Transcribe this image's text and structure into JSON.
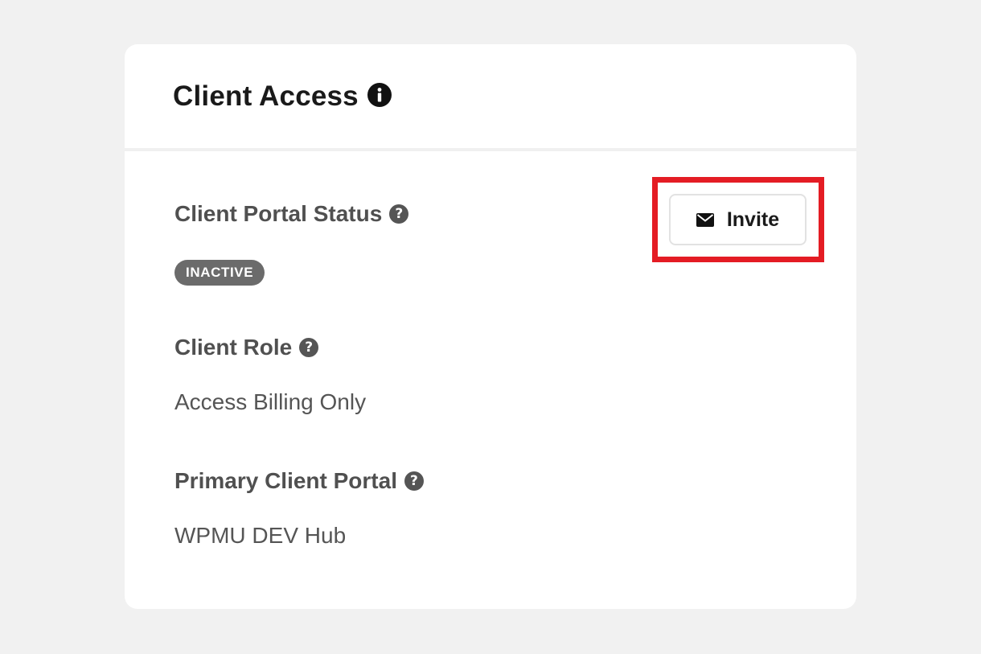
{
  "card": {
    "title": "Client Access",
    "title_icon": "info-icon"
  },
  "fields": {
    "portal_status": {
      "label": "Client Portal Status",
      "help_icon": "help-icon",
      "badge": "INACTIVE"
    },
    "client_role": {
      "label": "Client Role",
      "help_icon": "help-icon",
      "value": "Access Billing Only"
    },
    "primary_portal": {
      "label": "Primary Client Portal",
      "help_icon": "help-icon",
      "value": "WPMU DEV Hub"
    }
  },
  "invite_button": {
    "label": "Invite",
    "icon": "mail-icon"
  },
  "help_glyph": "?",
  "colors": {
    "highlight": "#e41c24",
    "badge_bg": "#6b6b6b",
    "background": "#f1f1f1"
  }
}
